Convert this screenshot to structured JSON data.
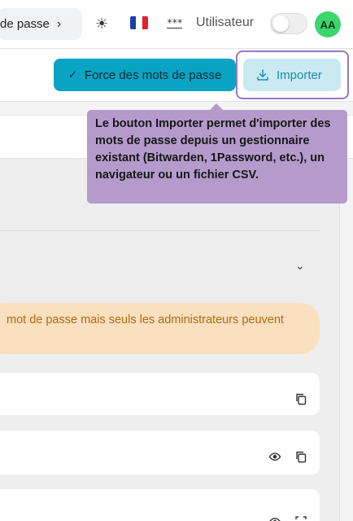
{
  "header": {
    "breadcrumb": "de passe",
    "user_label": "Utilisateur",
    "avatar_initials": "AA",
    "flag_colors": [
      "#1f3fa8",
      "#ffffff",
      "#e0222f"
    ],
    "icons": [
      "chevron-right-icon",
      "sun-icon",
      "flag-fr-icon",
      "password-dots-icon"
    ]
  },
  "toolbar": {
    "strength_button": "Force des mots de passe",
    "import_button": "Importer"
  },
  "tooltip": {
    "text": "Le bouton Importer permet d'importer des mots de passe depuis un gestionnaire existant (Bitwarden, 1Password, etc.), un navigateur ou un fichier CSV."
  },
  "main": {
    "notice": "mot de passe mais seuls les administrateurs peuvent"
  },
  "colors": {
    "accent": "#0aa3c4",
    "import_bg": "#c9eaf1",
    "tooltip_bg": "#b59bcc",
    "highlight_ring": "#9a77c4",
    "notice_bg": "#fae0bf",
    "avatar_bg": "#3bd66c"
  }
}
